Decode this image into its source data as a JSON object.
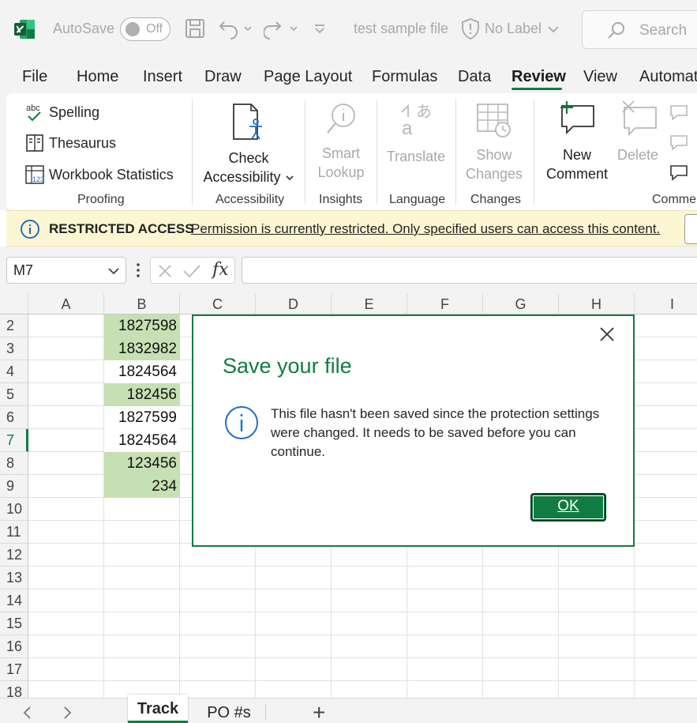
{
  "titlebar": {
    "autosave_label": "AutoSave",
    "autosave_state": "Off",
    "filename": "test sample file",
    "label_text": "No Label",
    "search_placeholder": "Search"
  },
  "menu": {
    "items": [
      "File",
      "Home",
      "Insert",
      "Draw",
      "Page Layout",
      "Formulas",
      "Data",
      "Review",
      "View",
      "Automat"
    ],
    "active": "Review"
  },
  "ribbon": {
    "proofing": {
      "spelling": "Spelling",
      "thesaurus": "Thesaurus",
      "workbook_statistics": "Workbook Statistics",
      "label": "Proofing"
    },
    "accessibility": {
      "check_line1": "Check",
      "check_line2": "Accessibility",
      "label": "Accessibility"
    },
    "insights": {
      "smart_line1": "Smart",
      "smart_line2": "Lookup",
      "label": "Insights"
    },
    "language": {
      "translate": "Translate",
      "label": "Language"
    },
    "changes": {
      "show_line1": "Show",
      "show_line2": "Changes",
      "label": "Changes"
    },
    "comments": {
      "new_line1": "New",
      "new_line2": "Comment",
      "delete": "Delete",
      "label": "Commen"
    },
    "icon_text": {
      "abc": "abc",
      "translate_glyph": "あ"
    }
  },
  "infobar": {
    "title": "RESTRICTED ACCESS",
    "message": "Permission is currently restricted. Only specified users can access this content."
  },
  "formula_bar": {
    "name_box": "M7",
    "fx_label": "fx",
    "formula": ""
  },
  "grid": {
    "columns": [
      "A",
      "B",
      "C",
      "D",
      "E",
      "F",
      "G",
      "H",
      "I"
    ],
    "rows": [
      "2",
      "3",
      "4",
      "5",
      "6",
      "7",
      "8",
      "9",
      "10",
      "11",
      "12",
      "13",
      "14",
      "15",
      "16",
      "17",
      "18"
    ],
    "selected_row": "7",
    "column_b_values": [
      "1827598",
      "1832982",
      "1824564",
      "182456",
      "1827599",
      "1824564",
      "123456",
      "234"
    ],
    "fill_color": "#c6e0b4"
  },
  "sheets": {
    "tabs": [
      "Track",
      "PO #s"
    ],
    "active": "Track",
    "add_label": "+"
  },
  "dialog": {
    "title": "Save your file",
    "message": "This file hasn't been saved since the protection settings were changed. It needs to be saved before you can continue.",
    "ok_label": "OK"
  },
  "colors": {
    "accent": "#107c41",
    "info_bar": "#fdf6d3",
    "info_icon": "#1e6fc6"
  }
}
